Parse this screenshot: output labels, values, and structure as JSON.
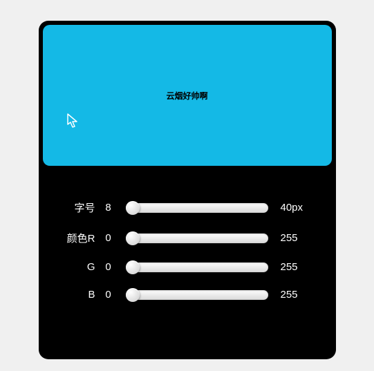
{
  "preview": {
    "text": "云烟好帅啊",
    "bgColor": "#14b9e6"
  },
  "sliders": [
    {
      "label": "字号",
      "min": "8",
      "max": "40px"
    },
    {
      "label": "颜色R",
      "min": "0",
      "max": "255"
    },
    {
      "label": "G",
      "min": "0",
      "max": "255"
    },
    {
      "label": "B",
      "min": "0",
      "max": "255"
    }
  ]
}
